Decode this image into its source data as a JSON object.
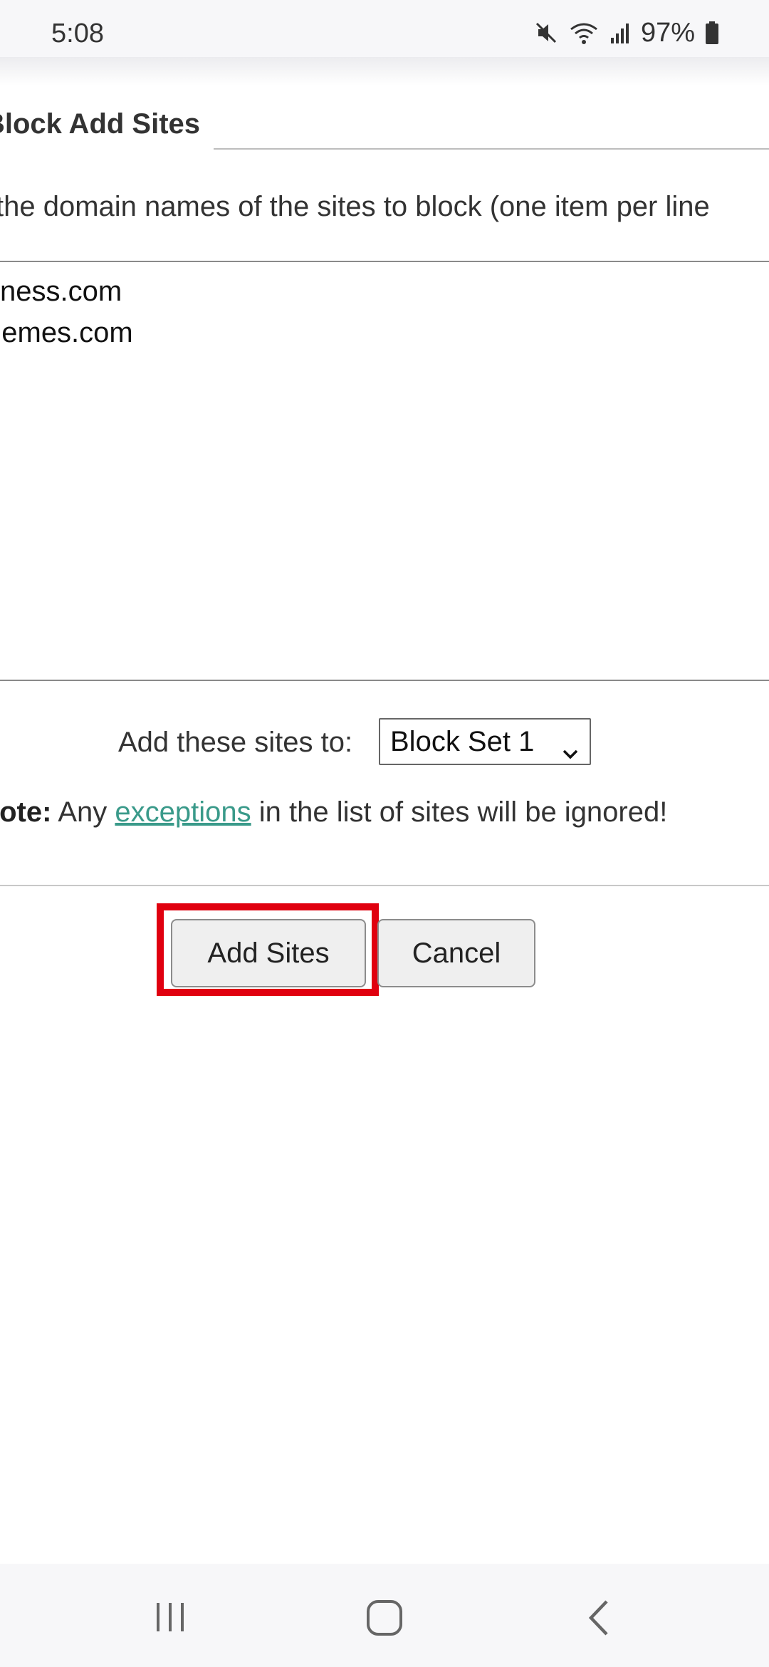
{
  "status_bar": {
    "time": "5:08",
    "battery_percent": "97%",
    "icons": [
      "mute-icon",
      "wifi-icon",
      "signal-icon",
      "battery-icon"
    ]
  },
  "form": {
    "legend": "Block Add Sites",
    "instructions": "the domain names of the sites to block (one item per line",
    "sites": [
      "sness.com",
      "nemes.com"
    ],
    "add_label": "Add these sites to:",
    "block_set_selected": "Block Set 1",
    "note_label": "lote:",
    "note_before": " Any ",
    "note_link": "exceptions",
    "note_after": " in the list of sites will be ignored!",
    "add_button": "Add Sites",
    "cancel_button": "Cancel"
  },
  "highlight_color": "#e0000f",
  "link_color": "#3a9a8a",
  "nav_bar": {
    "icons": [
      "recent-apps-icon",
      "home-icon",
      "back-icon"
    ]
  }
}
